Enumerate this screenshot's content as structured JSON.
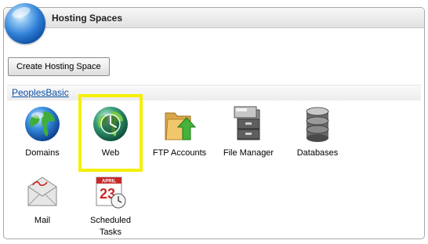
{
  "header": {
    "title": "Hosting Spaces"
  },
  "toolbar": {
    "create_label": "Create Hosting Space"
  },
  "space": {
    "name": "PeoplesBasic"
  },
  "tiles": [
    {
      "label": "Domains",
      "icon": "globe-icon"
    },
    {
      "label": "Web",
      "icon": "web-globe-icon",
      "highlighted": true
    },
    {
      "label": "FTP Accounts",
      "icon": "folder-upload-icon"
    },
    {
      "label": "File Manager",
      "icon": "file-cabinet-icon"
    },
    {
      "label": "Databases",
      "icon": "database-icon"
    },
    {
      "label": "Mail",
      "icon": "envelope-icon"
    },
    {
      "label": "Scheduled\nTasks",
      "icon": "calendar-clock-icon"
    }
  ],
  "calendar": {
    "month": "APRIL",
    "day": "23"
  },
  "colors": {
    "highlight": "#f5f000",
    "link": "#0a4fa5"
  }
}
